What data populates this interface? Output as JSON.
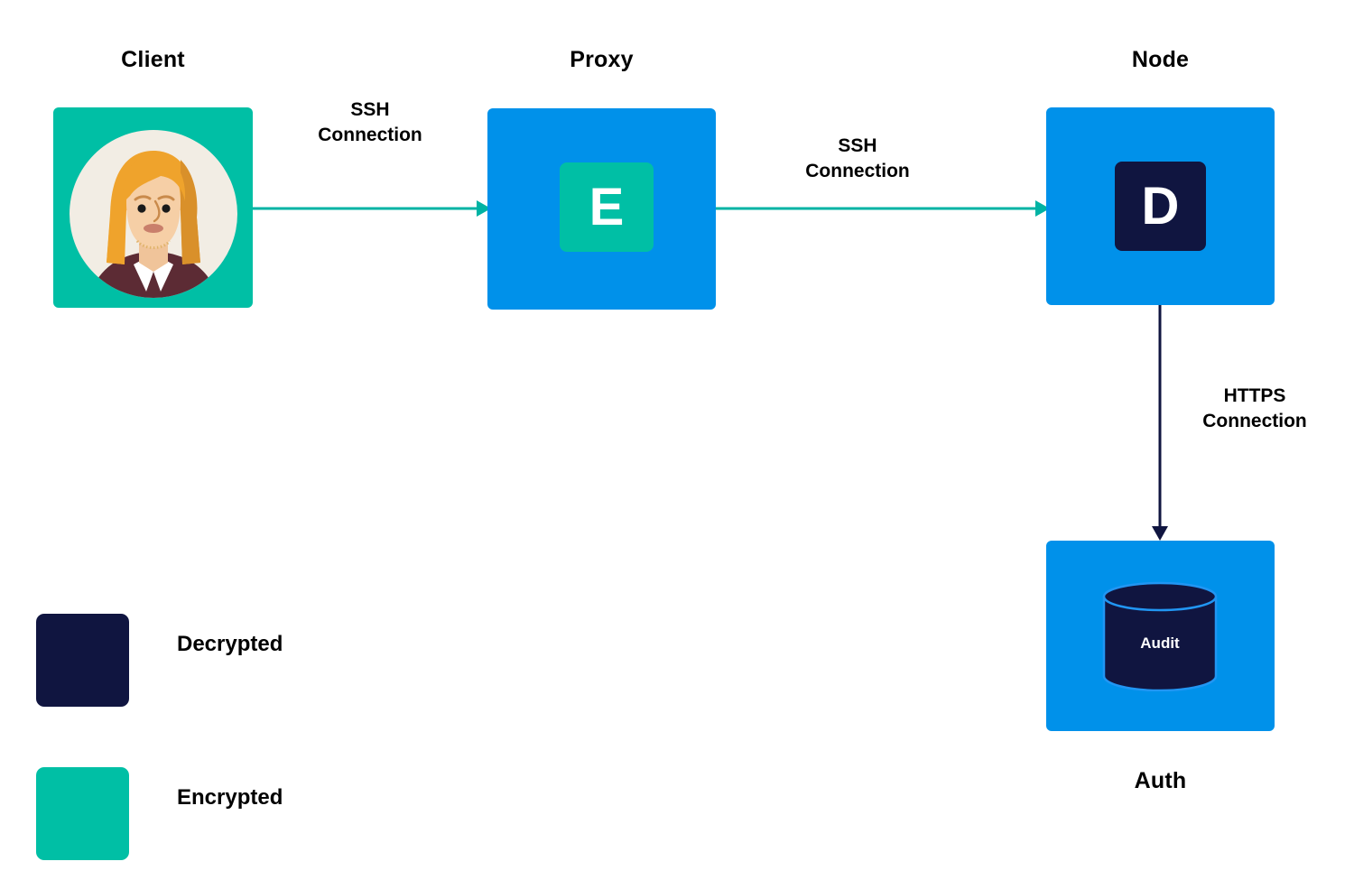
{
  "diagram": {
    "title_hidden": "Teleport SSH connection flow",
    "background": "#FFFFFF",
    "colors": {
      "encrypted_teal": "#00BFA5",
      "node_blue": "#0091EA",
      "decrypted_navy": "#101540",
      "arrow_ssh": "#00B3A4",
      "arrow_https": "#101540",
      "text_black": "#000000",
      "db_stroke": "#2196F3"
    },
    "nodes": [
      {
        "id": "client",
        "title": "Client",
        "state": "encrypted",
        "inner": "avatar"
      },
      {
        "id": "proxy",
        "title": "Proxy",
        "state": "node",
        "inner": "E"
      },
      {
        "id": "node",
        "title": "Node",
        "state": "node",
        "inner": "D"
      },
      {
        "id": "auth",
        "title": "Auth",
        "state": "node",
        "inner": "database"
      }
    ],
    "connections": [
      {
        "id": "client-to-proxy",
        "label": "SSH\nConnection",
        "protocol": "SSH",
        "from": "client",
        "to": "proxy",
        "color": "#00B3A4",
        "direction": "right"
      },
      {
        "id": "proxy-to-node",
        "label": "SSH\nConnection",
        "protocol": "SSH",
        "from": "proxy",
        "to": "node",
        "color": "#00B3A4",
        "direction": "right"
      },
      {
        "id": "node-to-auth",
        "label": "HTTPS\nConnection",
        "protocol": "HTTPS",
        "from": "node",
        "to": "auth",
        "color": "#101540",
        "direction": "down"
      }
    ],
    "database": {
      "label": "Audit"
    },
    "legend": {
      "items": [
        {
          "label": "Decrypted",
          "color": "#101540"
        },
        {
          "label": "Encrypted",
          "color": "#00BFA5"
        }
      ]
    }
  }
}
